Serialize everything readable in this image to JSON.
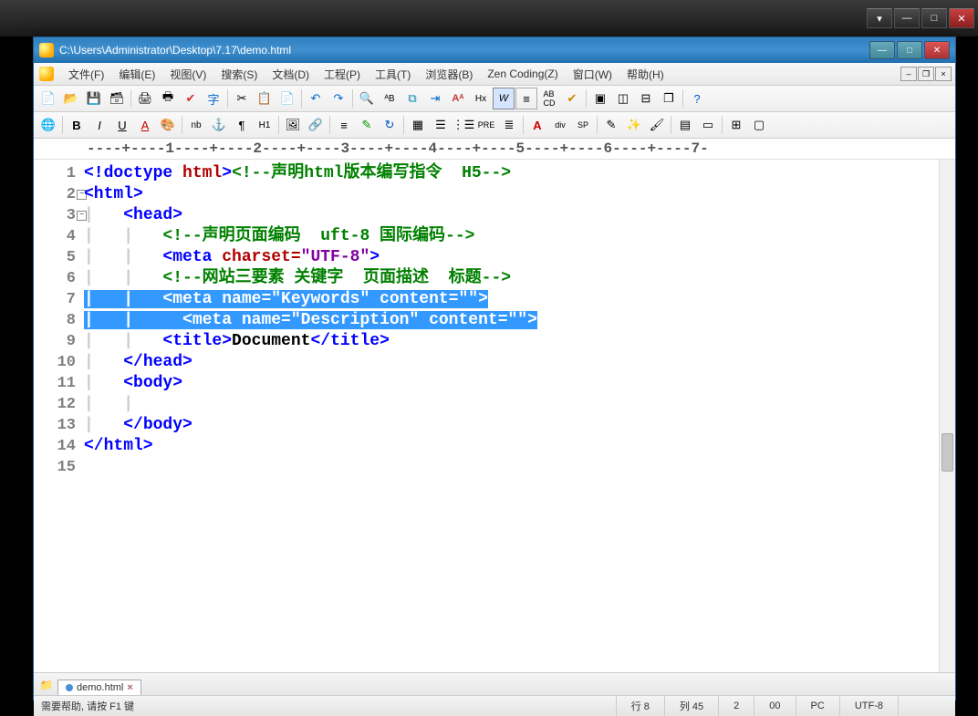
{
  "outerWindow": {
    "minimize": "—",
    "maximize": "□",
    "close": "✕",
    "extra": "▾"
  },
  "window": {
    "title": "C:\\Users\\Administrator\\Desktop\\7.17\\demo.html",
    "minimize": "—",
    "maximize": "□",
    "close": "✕"
  },
  "menu": [
    "文件(F)",
    "编辑(E)",
    "视图(V)",
    "搜索(S)",
    "文档(D)",
    "工程(P)",
    "工具(T)",
    "浏览器(B)",
    "Zen Coding(Z)",
    "窗口(W)",
    "帮助(H)"
  ],
  "mdi": {
    "min": "–",
    "restore": "❐",
    "close": "×"
  },
  "ruler": "----+----1----+----2----+----3----+----4----+----5----+----6----+----7-",
  "lines": [
    1,
    2,
    3,
    4,
    5,
    6,
    7,
    8,
    9,
    10,
    11,
    12,
    13,
    14,
    15
  ],
  "code": {
    "l1": {
      "a": "<!doctype ",
      "b": "html",
      "c": ">",
      "d": "<!--声明html版本编写指令  H5-->"
    },
    "l2": {
      "a": "<html>"
    },
    "l3": {
      "a": "<head>"
    },
    "l4": {
      "a": "<!--声明页面编码  uft-8 国际编码-->"
    },
    "l5": {
      "a": "<meta ",
      "b": "charset=",
      "c": "\"UTF-8\"",
      "d": ">"
    },
    "l6": {
      "a": "<!--网站三要素 关键字  页面描述  标题-->"
    },
    "l7": {
      "a": "<meta name=\"Keywords\" content=\"\">"
    },
    "l8": {
      "a": "<meta name=\"Description\" content=\"\">"
    },
    "l9": {
      "a": "<title>",
      "b": "Document",
      "c": "</title>"
    },
    "l10": {
      "a": "</head>"
    },
    "l11": {
      "a": "<body>"
    },
    "l12": {
      "a": ""
    },
    "l13": {
      "a": "</body>"
    },
    "l14": {
      "a": "</html>"
    }
  },
  "tab": {
    "name": "demo.html"
  },
  "status": {
    "help": "需要帮助, 请按 F1 键",
    "line": "行 8",
    "col": "列 45",
    "sel": "2",
    "ovr": "00",
    "mode": "PC",
    "enc": "UTF-8"
  }
}
